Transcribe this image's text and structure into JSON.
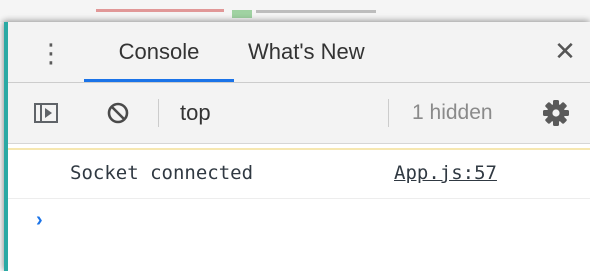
{
  "drawer": {
    "tabs": [
      {
        "label": "Console",
        "active": true
      },
      {
        "label": "What's New",
        "active": false
      }
    ],
    "menu_icon": "kebab-menu-icon",
    "close_label": "✕",
    "close_icon": "close-icon"
  },
  "toolbar": {
    "sidebar_icon": "show-sidebar-icon",
    "clear_icon": "clear-console-icon",
    "context": "top",
    "hidden_count": "1 hidden",
    "settings_icon": "gear-icon"
  },
  "console": {
    "messages": [
      {
        "text": "Socket connected",
        "source": "App.js:57"
      }
    ],
    "prompt_symbol": "›",
    "prompt_value": ""
  },
  "colors": {
    "accent": "#1a73e8",
    "left_edge": "#2aa9a4"
  }
}
